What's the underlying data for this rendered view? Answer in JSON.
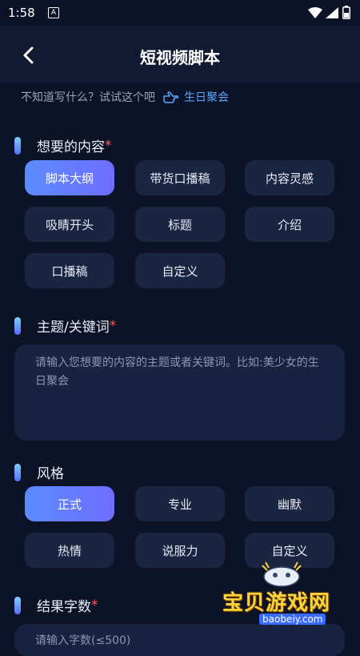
{
  "status": {
    "time": "1:58"
  },
  "header": {
    "title": "短视频脚本"
  },
  "hint": {
    "text": "不知道写什么？试试这个吧",
    "suggestion": "生日聚会"
  },
  "content_section": {
    "title": "想要的内容",
    "required_mark": "*",
    "options": [
      "脚本大纲",
      "带货口播稿",
      "内容灵感",
      "吸睛开头",
      "标题",
      "介绍",
      "口播稿",
      "自定义"
    ],
    "selected": "脚本大纲"
  },
  "topic_section": {
    "title": "主题/关键词",
    "required_mark": "*",
    "placeholder": "请输入您想要的内容的主题或者关键词。比如:美少女的生日聚会"
  },
  "style_section": {
    "title": "风格",
    "options": [
      "正式",
      "专业",
      "幽默",
      "热情",
      "说服力",
      "自定义"
    ],
    "selected": "正式"
  },
  "count_section": {
    "title": "结果字数",
    "required_mark": "*",
    "placeholder": "请输入字数(≤500)"
  },
  "watermark": {
    "text": "宝贝游戏网",
    "url": "baobeiy.com"
  },
  "colors": {
    "accent_start": "#5b8cff",
    "accent_end": "#6e6dff",
    "link": "#5aa8ff",
    "required": "#ff5a5a"
  }
}
